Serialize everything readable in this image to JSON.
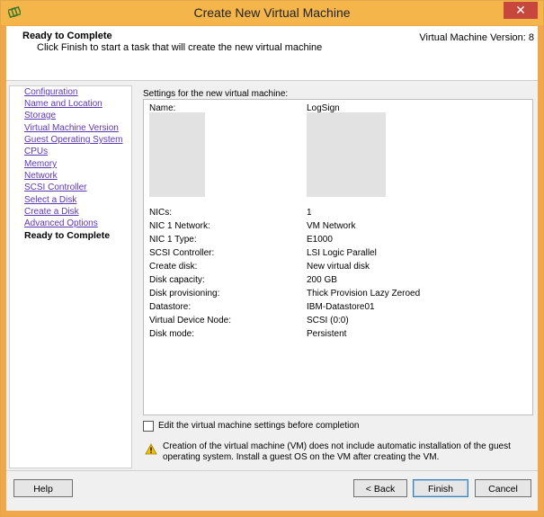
{
  "window": {
    "title": "Create New Virtual Machine",
    "close_label": "✕"
  },
  "header": {
    "title": "Ready to Complete",
    "subtitle": "Click Finish to start a task that will create the new virtual machine",
    "version": "Virtual Machine Version: 8"
  },
  "nav": {
    "items": [
      "Configuration",
      "Name and Location",
      "Storage",
      "Virtual Machine Version",
      "Guest Operating System",
      "CPUs",
      "Memory",
      "Network",
      "SCSI Controller",
      "Select a Disk",
      "Create a Disk",
      "Advanced Options"
    ],
    "current": "Ready to Complete"
  },
  "settings": {
    "label": "Settings for the new virtual machine:",
    "name_label": "Name:",
    "name_value": "LogSign",
    "rows": [
      {
        "label": "NICs:",
        "value": "1"
      },
      {
        "label": "NIC 1 Network:",
        "value": "VM Network"
      },
      {
        "label": "NIC 1 Type:",
        "value": "E1000"
      },
      {
        "label": "SCSI Controller:",
        "value": "LSI Logic Parallel"
      },
      {
        "label": "Create disk:",
        "value": "New virtual disk"
      },
      {
        "label": "Disk capacity:",
        "value": "200 GB"
      },
      {
        "label": "Disk provisioning:",
        "value": "Thick Provision Lazy Zeroed"
      },
      {
        "label": "Datastore:",
        "value": "IBM-Datastore01"
      },
      {
        "label": "Virtual Device Node:",
        "value": "SCSI (0:0)"
      },
      {
        "label": "Disk mode:",
        "value": "Persistent"
      }
    ]
  },
  "edit_checkbox": {
    "label": "Edit the virtual machine settings before completion",
    "checked": false
  },
  "warning": {
    "text": "Creation of the virtual machine (VM) does not include automatic installation of the guest operating system. Install a guest OS on the VM after creating the VM."
  },
  "buttons": {
    "help": "Help",
    "back": "< Back",
    "finish": "Finish",
    "cancel": "Cancel"
  }
}
